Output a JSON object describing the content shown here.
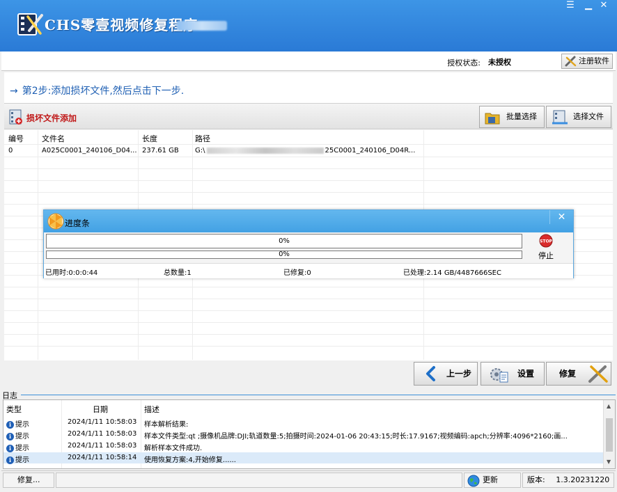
{
  "window": {
    "title": "CHS零壹视频修复程序",
    "controls": {
      "menu": "☰",
      "minimize": "▁",
      "close": "✕"
    },
    "accent": "#2f86dc"
  },
  "auth": {
    "label": "授权状态:",
    "value": "未授权",
    "register_button": "注册软件"
  },
  "step": {
    "text": "第2步:添加损坏文件,然后点击下一步."
  },
  "panel": {
    "title": "损坏文件添加",
    "batch_select": "批量选择",
    "select_file": "选择文件"
  },
  "table": {
    "columns": [
      "编号",
      "文件名",
      "长度",
      "路径"
    ],
    "rows": [
      {
        "id": "0",
        "filename": "A025C0001_240106_D04...",
        "size": "237.61 GB",
        "path_prefix": "G:\\",
        "path_suffix": "25C0001_240106_D04R..."
      }
    ]
  },
  "progress": {
    "title": "进度条",
    "close": "✕",
    "bar1_text": "0%",
    "bar2_text": "0%",
    "bar1_value": 0,
    "bar2_value": 0,
    "stop_icon_text": "STOP",
    "stop_label": "停止",
    "elapsed": "已用时:0:0:0:44",
    "total": "总数量:1",
    "repaired": "已修复:0",
    "processed": "已处理:2.14 GB/4487666SEC"
  },
  "nav": {
    "prev": "上一步",
    "settings": "设置",
    "repair": "修复"
  },
  "log": {
    "label": "日志",
    "columns": [
      "类型",
      "日期",
      "描述"
    ],
    "rows": [
      {
        "type": "提示",
        "date": "2024/1/11 10:58:03",
        "desc": "样本解析结果:"
      },
      {
        "type": "提示",
        "date": "2024/1/11 10:58:03",
        "desc": "样本文件类型:qt ;摄像机品牌:DJI;轨道数量:5;拍摄时间:2024-01-06 20:43:15;时长:17.9167;视频编码:apch;分辨率:4096*2160;画..."
      },
      {
        "type": "提示",
        "date": "2024/1/11 10:58:03",
        "desc": "解析样本文件成功."
      },
      {
        "type": "提示",
        "date": "2024/1/11 10:58:14",
        "desc": "使用恢复方案:4,开始修复......"
      }
    ]
  },
  "status": {
    "left": "修复...",
    "update": "更新",
    "version_label": "版本:",
    "version": "1.3.20231220"
  }
}
